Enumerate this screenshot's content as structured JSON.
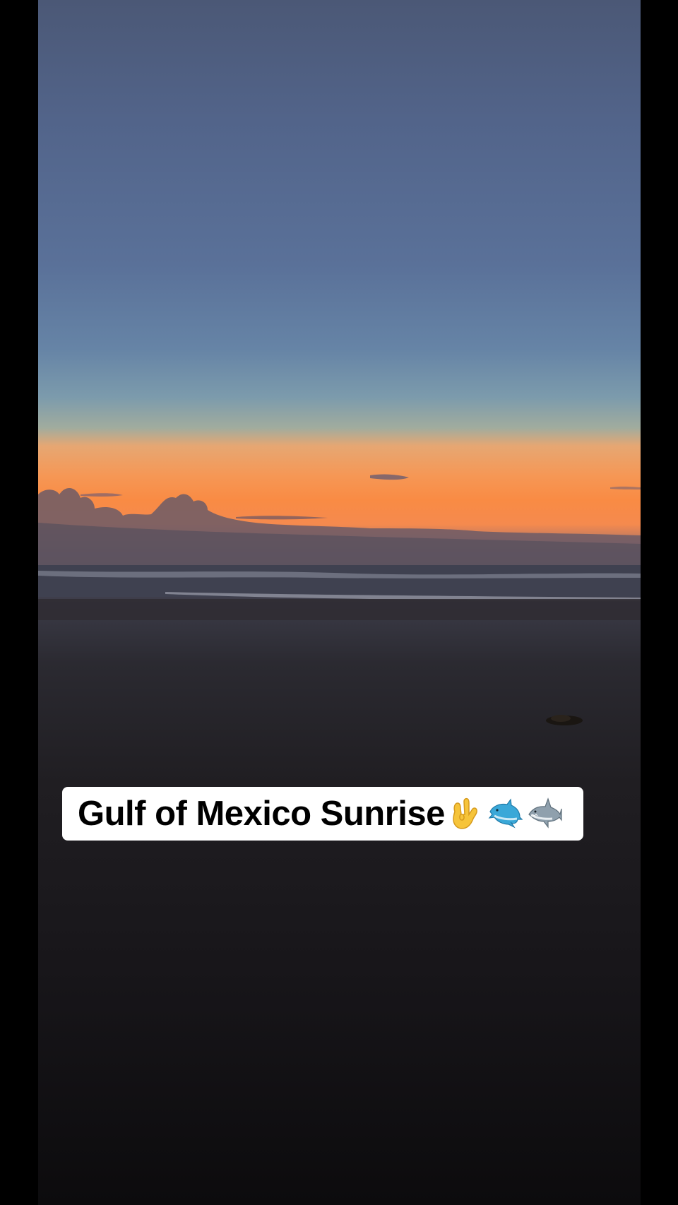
{
  "caption": {
    "text": "Gulf of Mexico Sunrise",
    "emojis": [
      "hand-horns-icon",
      "dolphin-icon",
      "shark-icon"
    ]
  },
  "colors": {
    "sky_top": "#4b5876",
    "horizon_orange": "#f98b44",
    "sand_dark": "#18161a",
    "letterbox": "#000000",
    "caption_bg": "#ffffff"
  }
}
